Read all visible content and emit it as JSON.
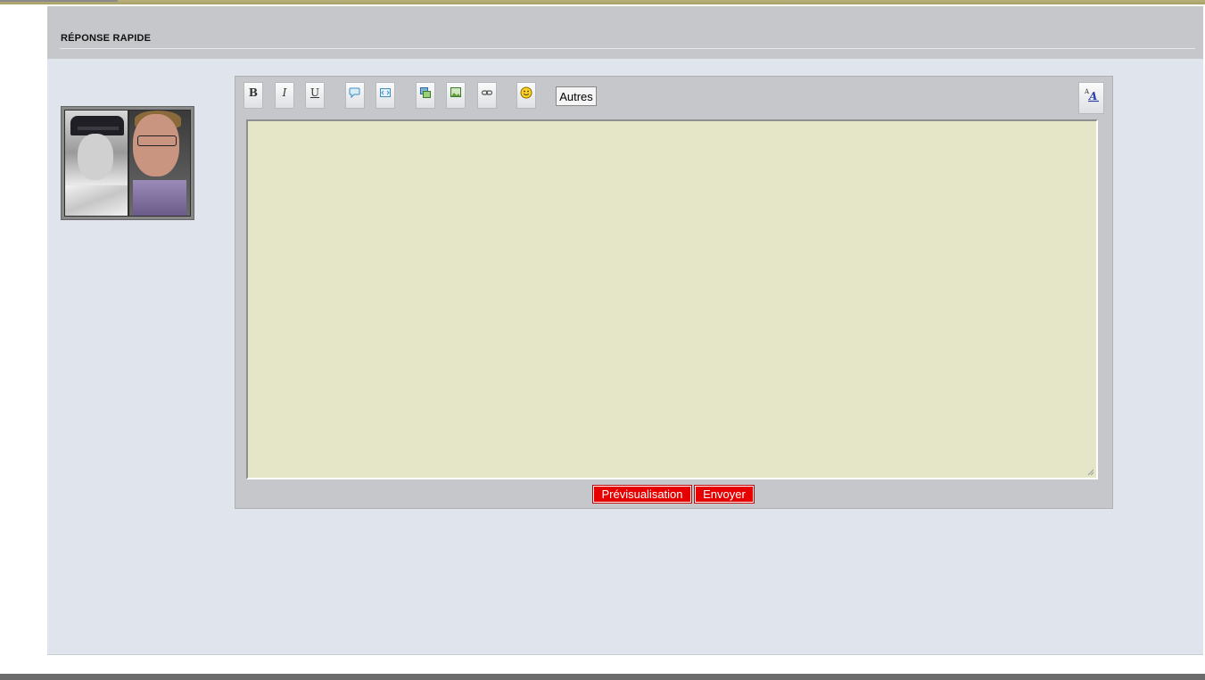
{
  "panel": {
    "title": "RÉPONSE RAPIDE"
  },
  "avatar": {
    "label": "user-avatar"
  },
  "toolbar": {
    "bold_label": "B",
    "italic_label": "I",
    "underline_label": "U",
    "quote_icon": "speech-bubble-icon",
    "code_icon": "code-icon",
    "image_host_icon": "image-host-icon",
    "image_icon": "image-icon",
    "link_icon": "link-icon",
    "smiley_icon": "smiley-icon",
    "others_label": "Autres",
    "font_toggle_icon": "font-style-icon"
  },
  "editor": {
    "message_value": "",
    "background_color": "#e5e6c7"
  },
  "actions": {
    "preview_label": "Prévisualisation",
    "send_label": "Envoyer",
    "button_color": "#e60000"
  }
}
